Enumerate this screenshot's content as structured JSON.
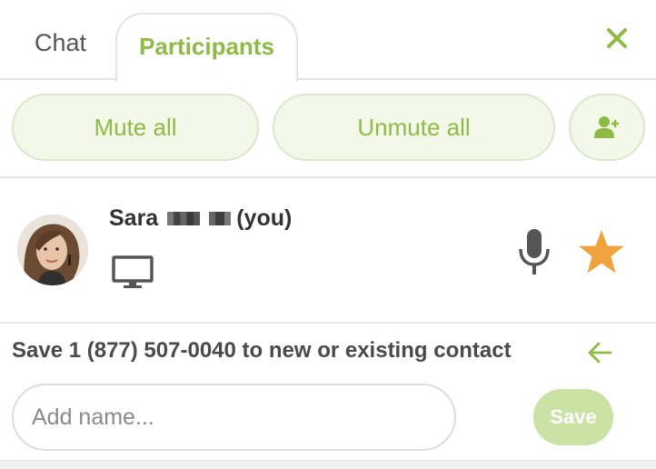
{
  "tabs": {
    "chat_label": "Chat",
    "participants_label": "Participants",
    "active": "Participants"
  },
  "actions": {
    "mute_all_label": "Mute all",
    "unmute_all_label": "Unmute all",
    "add_participant_icon": "add-user-icon"
  },
  "participant": {
    "first_name": "Sara",
    "suffix": "(you)",
    "device_icon": "desktop-icon",
    "mic_icon": "microphone-icon",
    "host_icon": "star-icon",
    "star_color": "#f0a23c"
  },
  "save_contact": {
    "text": "Save 1 (877) 507-0040 to new or existing contact",
    "input_placeholder": "Add name...",
    "input_value": "",
    "save_label": "Save"
  },
  "colors": {
    "accent": "#8dbb45",
    "pill_bg": "#f3f8e8",
    "save_disabled": "#cbe2a5"
  }
}
